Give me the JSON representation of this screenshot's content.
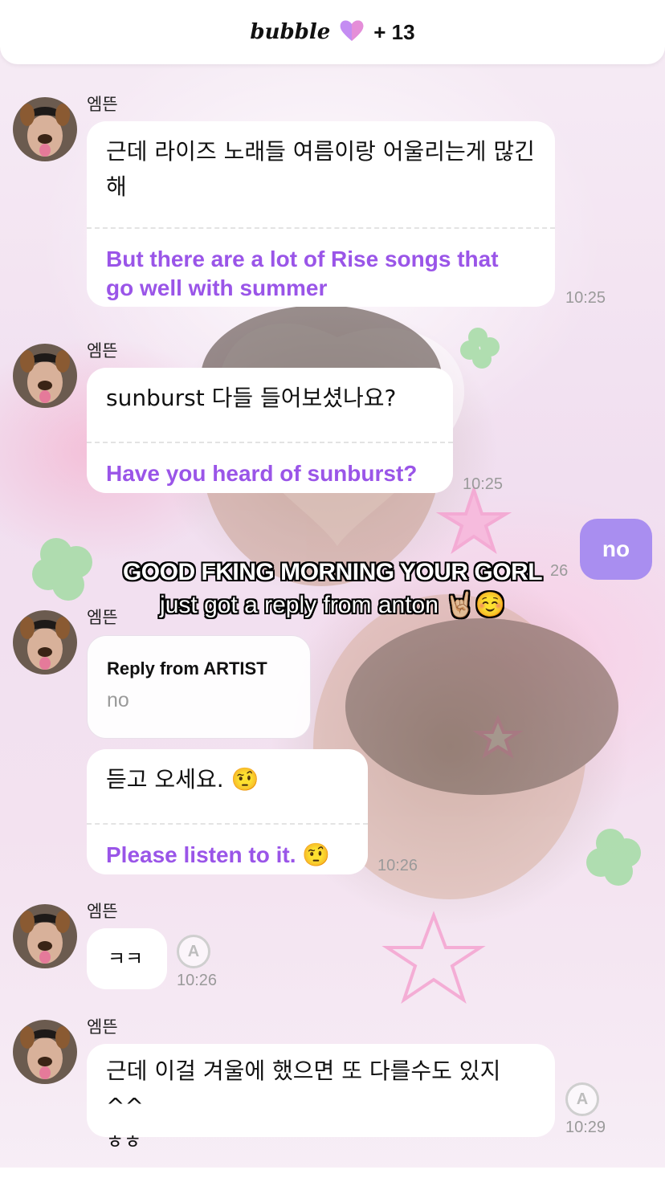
{
  "header": {
    "brand": "bubble",
    "plus_count": "+ 13"
  },
  "overlay": {
    "line1": "GOOD FKING MORNING YOUR GORL",
    "line2": "just got a reply from anton 🤘🏼☺️"
  },
  "sender_name": "엠뜬",
  "messages": {
    "m1": {
      "ko_line1": "근데 라이즈 노래들 여름이랑 어울리는게 많긴",
      "ko_line2": "해",
      "en_line1": "But there are a lot of Rise songs that",
      "en_line2": "go well with summer",
      "time": "10:25"
    },
    "m2": {
      "ko": "sunburst 다들 들어보셨나요?",
      "en": "Have you heard of sunburst?",
      "time": "10:25"
    },
    "sent": {
      "text": "no",
      "time": "10:26",
      "time_visible": "26"
    },
    "m3": {
      "reply_label": "Reply from ARTIST",
      "reply_quote": "no"
    },
    "m4": {
      "ko": "듣고 오세요. 🤨",
      "en": "Please listen to it. 🤨",
      "time": "10:26"
    },
    "m5": {
      "ko": "ㅋㅋ",
      "time": "10:26",
      "icon_letter": "A"
    },
    "m6": {
      "ko_line1": "근데 이걸 겨울에 했으면 또 다를수도 있지 ^^",
      "ko_line2": "ㅎㅎ",
      "time": "10:29",
      "icon_letter": "A"
    }
  },
  "colors": {
    "accent": "#9a55e8",
    "sent_bubble": "#a98ef0",
    "time": "#9a9a9a"
  },
  "icons": {
    "logo_heart": "purple-heart-icon",
    "avatar": "puppy-filter-avatar",
    "translate": "a-translate-icon"
  }
}
